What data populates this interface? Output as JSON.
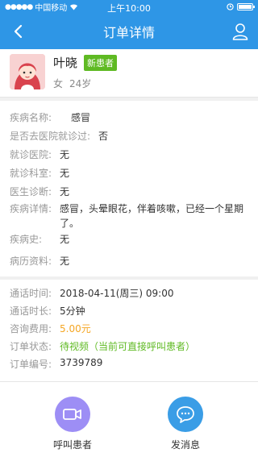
{
  "status_bar": {
    "carrier": "中国移动",
    "time": "上午10:00"
  },
  "nav": {
    "title": "订单详情"
  },
  "patient": {
    "name": "叶晓",
    "tag": "新患者",
    "gender": "女",
    "age": "24岁"
  },
  "info": {
    "disease_label": "疾病名称:",
    "disease_value": "感冒",
    "visited_label": "是否去医院就诊过:",
    "visited_value": "否",
    "hospital_label": "就诊医院:",
    "hospital_value": "无",
    "dept_label": "就诊科室:",
    "dept_value": "无",
    "diagnosis_label": "医生诊断:",
    "diagnosis_value": "无",
    "detail_label": "疾病详情:",
    "detail_value": "感冒，头晕眼花，伴着咳嗽，已经一个星期了。",
    "history_label": "疾病史:",
    "history_value": "无",
    "records_label": "病历资料:",
    "records_value": "无"
  },
  "order": {
    "call_time_label": "通话时间:",
    "call_time_value": "2018-04-11(周三) 09:00",
    "duration_label": "通话时长:",
    "duration_value": "5分钟",
    "fee_label": "咨询费用:",
    "fee_value": "5.00元",
    "status_label": "订单状态:",
    "status_value": "待视频（当前可直接呼叫患者）",
    "number_label": "订单编号:",
    "number_value": "3739789"
  },
  "actions": {
    "call_label": "呼叫患者",
    "message_label": "发消息"
  },
  "colors": {
    "primary": "#2e96e6",
    "green": "#5fba23",
    "orange": "#f5a623",
    "purple": "#9d8ef5",
    "blue_circle": "#3a9de6"
  },
  "icons": [
    "back-arrow-icon",
    "user-icon",
    "video-camera-icon",
    "chat-bubble-icon",
    "wifi-icon",
    "alarm-icon"
  ]
}
